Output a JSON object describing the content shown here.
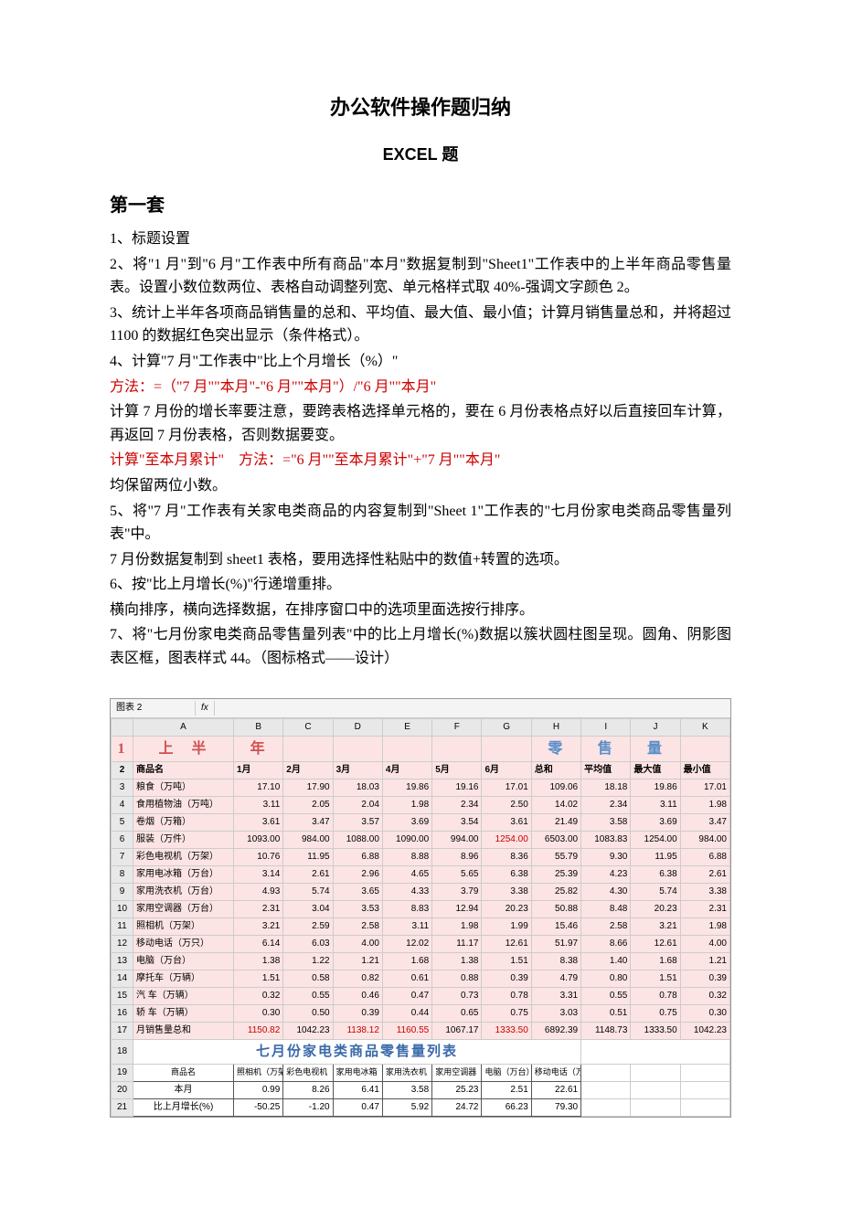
{
  "doc": {
    "title": "办公软件操作题归纳",
    "subtitle": "EXCEL 题",
    "section": "第一套",
    "p1": "1、标题设置",
    "p2": "2、将\"1 月\"到\"6 月\"工作表中所有商品\"本月\"数据复制到\"Sheet1\"工作表中的上半年商品零售量表。设置小数位数两位、表格自动调整列宽、单元格样式取 40%-强调文字颜色 2。",
    "p3": "3、统计上半年各项商品销售量的总和、平均值、最大值、最小值；计算月销售量总和，并将超过 1100 的数据红色突出显示（条件格式）。",
    "p4": "4、计算\"7 月\"工作表中\"比上个月增长（%）\"",
    "p5": "方法：=（\"7 月\"\"本月\"-\"6 月\"\"本月\"）/\"6 月\"\"本月\"",
    "p6": "计算 7 月份的增长率要注意，要跨表格选择单元格的，要在 6 月份表格点好以后直接回车计算，再返回 7 月份表格，否则数据要变。",
    "p7": "计算\"至本月累计\"　方法：=\"6 月\"\"至本月累计\"+\"7 月\"\"本月\"",
    "p8": "均保留两位小数。",
    "p9": "5、将\"7 月\"工作表有关家电类商品的内容复制到\"Sheet 1\"工作表的\"七月份家电类商品零售量列表\"中。",
    "p10": "7 月份数据复制到 sheet1 表格，要用选择性粘贴中的数值+转置的选项。",
    "p11": "6、按\"比上月增长(%)\"行递增重排。",
    "p12": "横向排序，横向选择数据，在排序窗口中的选项里面选按行排序。",
    "p13": "7、将\"七月份家电类商品零售量列表\"中的比上月增长(%)数据以簇状圆柱图呈现。圆角、阴影图表区框，图表样式 44。（图标格式——设计）"
  },
  "ss": {
    "namebox": "图表 2",
    "fx": "fx",
    "colheads": [
      "A",
      "B",
      "C",
      "D",
      "E",
      "F",
      "G",
      "H",
      "I",
      "J",
      "K"
    ],
    "t1a": "上　半",
    "t1b": "年",
    "t1c": "",
    "t1d": "零",
    "t1e": "售",
    "t1f": "量",
    "hdr": [
      "商品名",
      "1月",
      "2月",
      "3月",
      "4月",
      "5月",
      "6月",
      "总和",
      "平均值",
      "最大值",
      "最小值"
    ],
    "rows": [
      [
        "粮食（万吨）",
        "17.10",
        "17.90",
        "18.03",
        "19.86",
        "19.16",
        "17.01",
        "109.06",
        "18.18",
        "19.86",
        "17.01"
      ],
      [
        "食用植物油（万吨）",
        "3.11",
        "2.05",
        "2.04",
        "1.98",
        "2.34",
        "2.50",
        "14.02",
        "2.34",
        "3.11",
        "1.98"
      ],
      [
        "卷烟（万箱）",
        "3.61",
        "3.47",
        "3.57",
        "3.69",
        "3.54",
        "3.61",
        "21.49",
        "3.58",
        "3.69",
        "3.47"
      ],
      [
        "服装（万件）",
        "1093.00",
        "984.00",
        "1088.00",
        "1090.00",
        "994.00",
        "1254.00",
        "6503.00",
        "1083.83",
        "1254.00",
        "984.00"
      ],
      [
        "彩色电视机（万架）",
        "10.76",
        "11.95",
        "6.88",
        "8.88",
        "8.96",
        "8.36",
        "55.79",
        "9.30",
        "11.95",
        "6.88"
      ],
      [
        "家用电冰箱（万台）",
        "3.14",
        "2.61",
        "2.96",
        "4.65",
        "5.65",
        "6.38",
        "25.39",
        "4.23",
        "6.38",
        "2.61"
      ],
      [
        "家用洗衣机（万台）",
        "4.93",
        "5.74",
        "3.65",
        "4.33",
        "3.79",
        "3.38",
        "25.82",
        "4.30",
        "5.74",
        "3.38"
      ],
      [
        "家用空调器（万台）",
        "2.31",
        "3.04",
        "3.53",
        "8.83",
        "12.94",
        "20.23",
        "50.88",
        "8.48",
        "20.23",
        "2.31"
      ],
      [
        "照相机（万架）",
        "3.21",
        "2.59",
        "2.58",
        "3.11",
        "1.98",
        "1.99",
        "15.46",
        "2.58",
        "3.21",
        "1.98"
      ],
      [
        "移动电话（万只）",
        "6.14",
        "6.03",
        "4.00",
        "12.02",
        "11.17",
        "12.61",
        "51.97",
        "8.66",
        "12.61",
        "4.00"
      ],
      [
        "电脑（万台）",
        "1.38",
        "1.22",
        "1.21",
        "1.68",
        "1.38",
        "1.51",
        "8.38",
        "1.40",
        "1.68",
        "1.21"
      ],
      [
        "摩托车（万辆）",
        "1.51",
        "0.58",
        "0.82",
        "0.61",
        "0.88",
        "0.39",
        "4.79",
        "0.80",
        "1.51",
        "0.39"
      ],
      [
        "汽 车（万辆）",
        "0.32",
        "0.55",
        "0.46",
        "0.47",
        "0.73",
        "0.78",
        "3.31",
        "0.55",
        "0.78",
        "0.32"
      ],
      [
        "轿 车（万辆）",
        "0.30",
        "0.50",
        "0.39",
        "0.44",
        "0.65",
        "0.75",
        "3.03",
        "0.51",
        "0.75",
        "0.30"
      ]
    ],
    "totalrow": [
      "月销售量总和",
      "1150.82",
      "1042.23",
      "1138.12",
      "1160.55",
      "1067.17",
      "1333.50",
      "6892.39",
      "1148.73",
      "1333.50",
      "1042.23"
    ],
    "jtitle": "七月份家电类商品零售量列表",
    "jhdr": [
      "商品名",
      "照相机（万架）",
      "彩色电视机（万架）",
      "家用电冰箱（万台）",
      "家用洗衣机（万台）",
      "家用空调器（万架）",
      "电脑（万台）",
      "移动电话（万只）"
    ],
    "jr1": [
      "本月",
      "0.99",
      "8.26",
      "6.41",
      "3.58",
      "25.23",
      "2.51",
      "22.61"
    ],
    "jr2": [
      "比上月增长(%)",
      "-50.25",
      "-1.20",
      "0.47",
      "5.92",
      "24.72",
      "66.23",
      "79.30"
    ]
  }
}
